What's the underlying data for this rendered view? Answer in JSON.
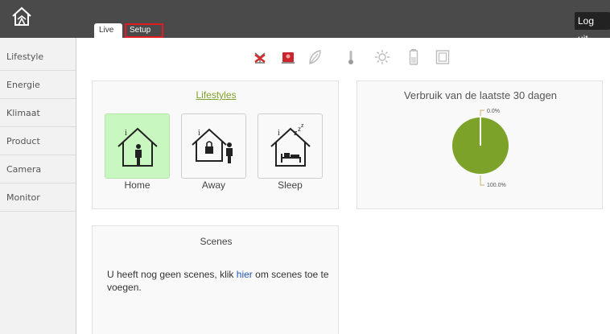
{
  "header": {
    "logout_label": "Log uit",
    "tabs": [
      {
        "label": "Live",
        "active": true
      },
      {
        "label": "Setup",
        "highlighted": true
      }
    ],
    "bar_color": "#4a4a4a"
  },
  "sidebar": {
    "items": [
      {
        "label": "Lifestyle"
      },
      {
        "label": "Energie"
      },
      {
        "label": "Klimaat"
      },
      {
        "label": "Product"
      },
      {
        "label": "Camera"
      },
      {
        "label": "Monitor"
      }
    ]
  },
  "status_icons": [
    "network-disconnected-icon",
    "alarm-icon",
    "leaf-icon",
    "thermometer-icon",
    "sun-icon",
    "battery-icon",
    "window-icon"
  ],
  "lifestyles": {
    "title": "Lifestyles",
    "items": [
      {
        "label": "Home",
        "active": true,
        "icon": "home-person-icon"
      },
      {
        "label": "Away",
        "active": false,
        "icon": "home-lock-icon"
      },
      {
        "label": "Sleep",
        "active": false,
        "icon": "home-bed-icon"
      }
    ],
    "active_color": "#c8f7c0"
  },
  "chart_data": {
    "type": "pie",
    "title": "Verbruik van de laatste 30 dagen",
    "slices": [
      {
        "label": "0.0%",
        "value": 0
      },
      {
        "label": "100.0%",
        "value": 100
      }
    ],
    "colors": [
      "#7da22a",
      "#7da22a"
    ]
  },
  "scenes": {
    "title": "Scenes",
    "text_before": "U heeft nog geen scenes, klik",
    "link": "hier",
    "text_after": "om scenes toe te voegen."
  }
}
